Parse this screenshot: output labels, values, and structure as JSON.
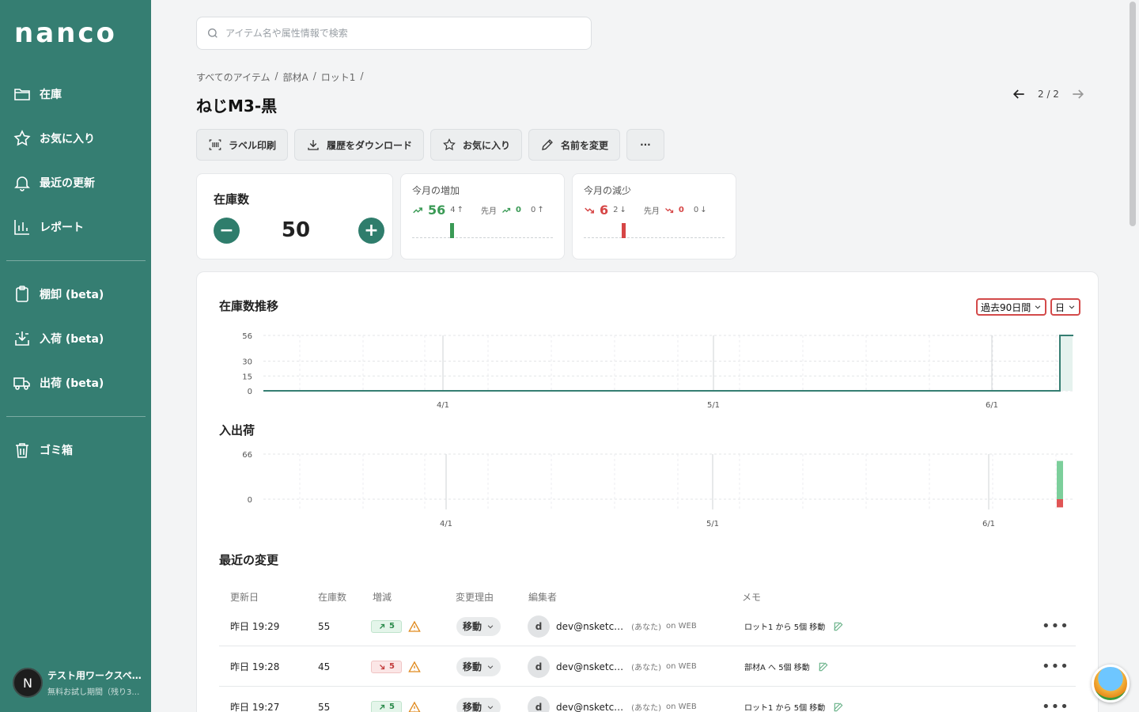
{
  "sidebar": {
    "logo": "nanco",
    "items": [
      {
        "label": "在庫"
      },
      {
        "label": "お気に入り"
      },
      {
        "label": "最近の更新"
      },
      {
        "label": "レポート"
      },
      {
        "label": "棚卸 (beta)"
      },
      {
        "label": "入荷 (beta)"
      },
      {
        "label": "出荷 (beta)"
      },
      {
        "label": "ゴミ箱"
      }
    ],
    "workspace": {
      "initial": "N",
      "name": "テスト用ワークスペ…",
      "sub": "無料お試し期間（残り3…"
    }
  },
  "search": {
    "placeholder": "アイテム名や属性情報で検索"
  },
  "breadcrumb": [
    "すべてのアイテム",
    "/",
    "部材A",
    "/",
    "ロット1",
    "/"
  ],
  "title": "ねじM3-黒",
  "pager": "2 / 2",
  "actions": {
    "label_print": "ラベル印刷",
    "download": "履歴をダウンロード",
    "favorite": "お気に入り",
    "rename": "名前を変更",
    "more": "···"
  },
  "stock": {
    "title": "在庫数",
    "value": "50",
    "minus": "−",
    "plus": "+"
  },
  "increase": {
    "title": "今月の増加",
    "value": "56",
    "count": "4",
    "prev_label": "先月",
    "prev_value": "0",
    "prev_count": "0",
    "color": "#3a9a55"
  },
  "decrease": {
    "title": "今月の減少",
    "value": "6",
    "count": "2",
    "prev_label": "先月",
    "prev_value": "0",
    "prev_count": "0",
    "color": "#d64545"
  },
  "trend": {
    "title": "在庫数推移",
    "range": "過去90日間",
    "unit": "日"
  },
  "flow": {
    "title": "入出荷"
  },
  "chart_data": [
    {
      "type": "area",
      "title": "在庫数推移",
      "yticks": [
        0,
        15,
        30,
        56
      ],
      "ylim": [
        0,
        56
      ],
      "x_ticks": [
        "4/1",
        "5/1",
        "6/1"
      ],
      "series": [
        {
          "values_note_end": [
            0,
            56
          ]
        }
      ],
      "x": [
        "3/11",
        "6/8",
        "6/9"
      ],
      "y": [
        0,
        0,
        56
      ]
    },
    {
      "type": "bar",
      "title": "入出荷",
      "yticks": [
        0,
        66
      ],
      "ylim": [
        -15,
        66
      ],
      "x_ticks": [
        "4/1",
        "5/1",
        "6/1"
      ],
      "x": [
        "6/9"
      ],
      "in": [
        56
      ],
      "out": [
        6
      ]
    }
  ],
  "recent": {
    "title": "最近の変更",
    "headers": [
      "更新日",
      "在庫数",
      "増減",
      "変更理由",
      "編集者",
      "メモ"
    ],
    "rows": [
      {
        "date": "昨日 19:29",
        "qty": "55",
        "dir": "up",
        "delta": "5",
        "reason": "移動",
        "editor_initial": "d",
        "editor": "dev@nsketc…",
        "you": "(あなた)",
        "via": "on WEB",
        "memo": "ロット1 から 5個 移動"
      },
      {
        "date": "昨日 19:28",
        "qty": "45",
        "dir": "down",
        "delta": "5",
        "reason": "移動",
        "editor_initial": "d",
        "editor": "dev@nsketc…",
        "you": "(あなた)",
        "via": "on WEB",
        "memo": "部材A へ 5個 移動"
      },
      {
        "date": "昨日 19:27",
        "qty": "55",
        "dir": "up",
        "delta": "5",
        "reason": "移動",
        "editor_initial": "d",
        "editor": "dev@nsketc…",
        "you": "(あなた)",
        "via": "on WEB",
        "memo": "ロット1 から 5個 移動"
      }
    ]
  }
}
